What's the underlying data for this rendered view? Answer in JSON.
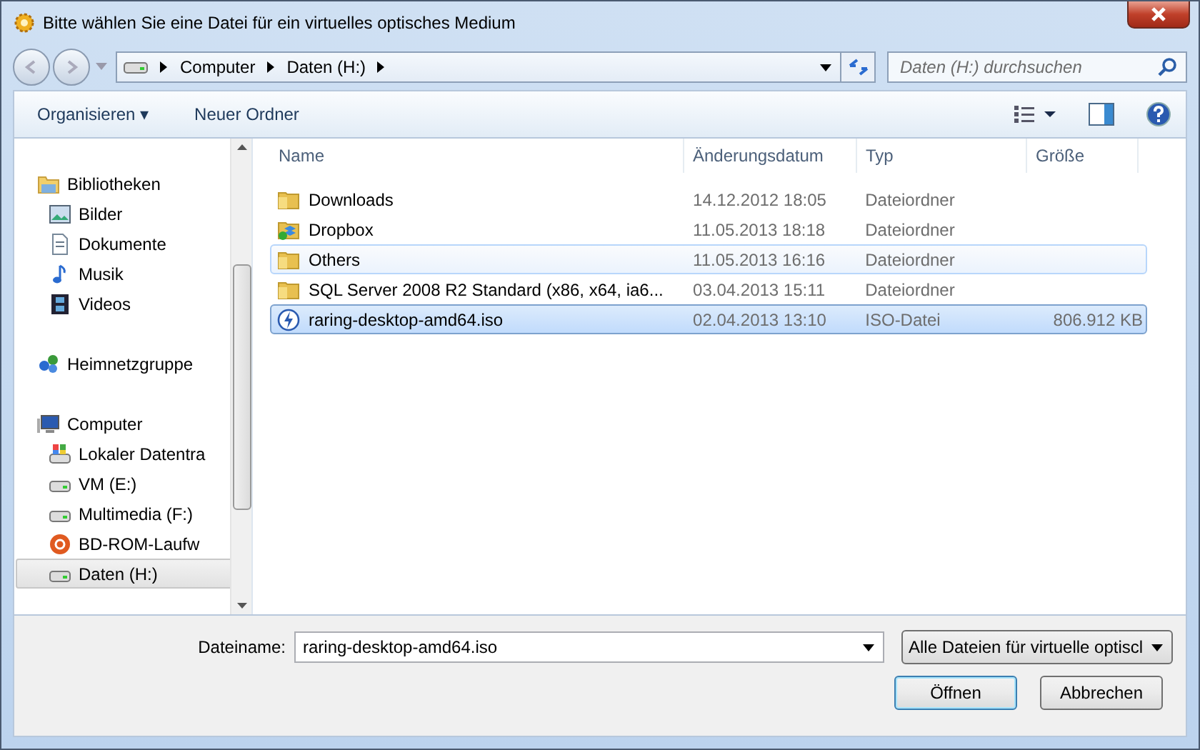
{
  "window": {
    "title": "Bitte wählen Sie eine Datei für ein virtuelles optisches Medium"
  },
  "address_bar": {
    "crumbs": [
      "Computer",
      "Daten (H:)"
    ]
  },
  "search": {
    "placeholder": "Daten (H:) durchsuchen"
  },
  "toolbar": {
    "buttons": [
      "Organisieren ▾",
      "Neuer Ordner"
    ]
  },
  "sidebar": {
    "items": [
      {
        "label": "Bibliotheken",
        "kind": "library",
        "selected": false,
        "children": [
          {
            "label": "Bilder",
            "kind": "pictures",
            "selected": false
          },
          {
            "label": "Dokumente",
            "kind": "documents",
            "selected": false
          },
          {
            "label": "Musik",
            "kind": "music",
            "selected": false
          },
          {
            "label": "Videos",
            "kind": "videos",
            "selected": false
          }
        ]
      },
      {
        "label": "Heimnetzgruppe",
        "kind": "homegroup",
        "selected": false
      },
      {
        "label": "Computer",
        "kind": "computer",
        "selected": false,
        "children": [
          {
            "label": "Lokaler Datentra",
            "kind": "system-drive",
            "selected": false
          },
          {
            "label": "VM (E:)",
            "kind": "drive",
            "selected": false
          },
          {
            "label": "Multimedia (F:)",
            "kind": "drive",
            "selected": false
          },
          {
            "label": "BD-ROM-Laufw",
            "kind": "optical-drive",
            "selected": false
          },
          {
            "label": "Daten (H:)",
            "kind": "drive",
            "selected": true
          }
        ]
      }
    ]
  },
  "table": {
    "columns": [
      "Name",
      "Änderungsdatum",
      "Typ",
      "Größe"
    ],
    "rows": [
      {
        "name": "Downloads",
        "date": "14.12.2012 18:05",
        "type": "Dateiordner",
        "kind": "folder",
        "selected": false,
        "hovered": false
      },
      {
        "name": "Dropbox",
        "date": "11.05.2013 18:18",
        "type": "Dateiordner",
        "kind": "synced-folder",
        "selected": false,
        "hovered": false
      },
      {
        "name": "Others",
        "date": "11.05.2013 16:16",
        "type": "Dateiordner",
        "kind": "folder",
        "selected": false,
        "hovered": true
      },
      {
        "name": "SQL Server 2008 R2 Standard (x86, x64, ia6...",
        "date": "03.04.2013 15:11",
        "type": "Dateiordner",
        "kind": "folder",
        "selected": false,
        "hovered": false
      },
      {
        "name": "raring-desktop-amd64.iso",
        "date": "02.04.2013 13:10",
        "type": "ISO-Datei",
        "size": "806.912 KB",
        "kind": "disc-image",
        "selected": true,
        "hovered": false
      }
    ]
  },
  "filename": {
    "label": "Dateiname:",
    "value": "raring-desktop-amd64.iso"
  },
  "filter": {
    "value": "Alle Dateien für virtuelle optiscl"
  },
  "buttons": [
    "Öffnen",
    "Abbrechen"
  ]
}
